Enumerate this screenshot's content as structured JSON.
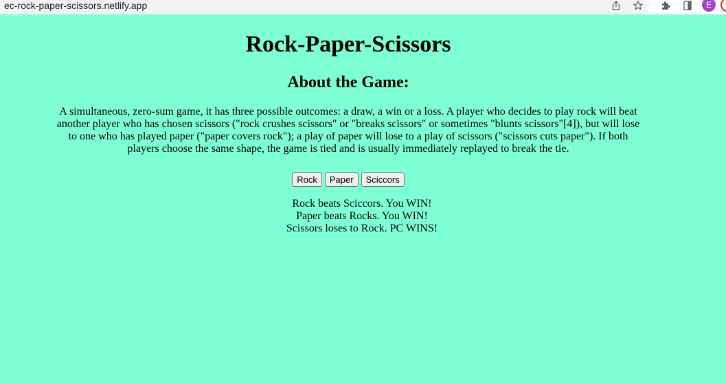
{
  "browser": {
    "url": "ec-rock-paper-scissors.netlify.app",
    "profile_initial": "E",
    "icons": [
      "share-icon",
      "star-icon",
      "extensions-icon",
      "sidepanel-icon"
    ]
  },
  "page": {
    "title": "Rock-Paper-Scissors",
    "about_heading": "About the Game:",
    "about_text": "A simultaneous, zero-sum game, it has three possible outcomes: a draw, a win or a loss. A player who decides to play rock will beat another player who has chosen scissors (\"rock crushes scissors\" or \"breaks scissors\" or sometimes \"blunts scissors\"[4]), but will lose to one who has played paper (\"paper covers rock\"); a play of paper will lose to a play of scissors (\"scissors cuts paper\"). If both players choose the same shape, the game is tied and is usually immediately replayed to break the tie.",
    "buttons": {
      "rock": "Rock",
      "paper": "Paper",
      "scissors": "Sciccors"
    },
    "results": [
      "Rock beats Sciccors. You WIN!",
      "Paper beats Rocks. You WIN!",
      "Scissors loses to Rock. PC WINS!"
    ]
  },
  "colors": {
    "background": "#7fffd4",
    "avatar": "#a142c9"
  }
}
